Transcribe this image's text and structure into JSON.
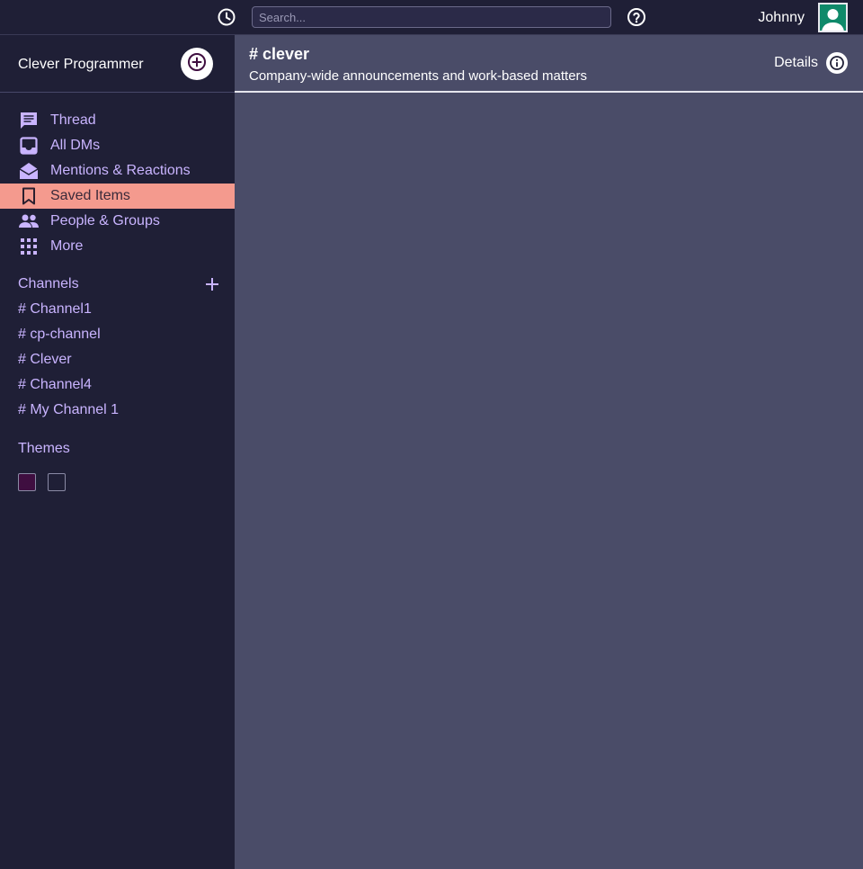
{
  "topbar": {
    "history_icon": "clock-icon",
    "search_placeholder": "Search...",
    "help_icon": "question-circle-icon",
    "username": "Johnny",
    "avatar_icon": "user-avatar-icon"
  },
  "sidebar": {
    "workspace_name": "Clever Programmer",
    "compose_icon": "plus-circle-icon",
    "nav_items": [
      {
        "label": "Thread",
        "icon": "chat-bubble-icon"
      },
      {
        "label": "All DMs",
        "icon": "inbox-icon"
      },
      {
        "label": "Mentions & Reactions",
        "icon": "envelope-open-icon"
      },
      {
        "label": "Saved Items",
        "icon": "bookmark-icon"
      },
      {
        "label": "People & Groups",
        "icon": "people-icon"
      },
      {
        "label": "More",
        "icon": "grid-icon"
      }
    ],
    "active_nav": "Saved Items",
    "channels_label": "Channels",
    "channels": [
      "# Channel1",
      "# cp-channel",
      "# Clever",
      "# Channel4",
      "# My Channel 1"
    ],
    "themes_label": "Themes",
    "theme_colors": [
      "#3f0e40",
      "#1f1f36"
    ]
  },
  "main": {
    "channel_title": "# clever",
    "channel_description": "Company-wide announcements and work-based matters",
    "details_label": "Details",
    "details_icon": "info-icon"
  },
  "colors": {
    "sidebar_bg": "#1f1f36",
    "main_bg": "#4a4c68",
    "accent_text": "#c9b4ff",
    "active_item": "#f49a8e"
  }
}
